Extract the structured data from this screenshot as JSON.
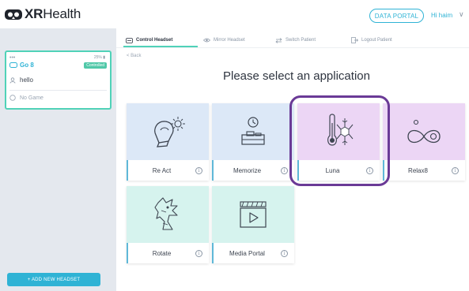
{
  "header": {
    "logo_bold": "XR",
    "logo_rest": "Health",
    "portal_button": "DATA PORTAL",
    "greeting": "Hi haim",
    "caret": "∨"
  },
  "sidebar": {
    "headset": {
      "dots": "•••",
      "battery": "25% ▮",
      "name": "Go 8",
      "status": "Controlled",
      "user": "hello",
      "game": "No Game"
    },
    "add_button": "+ ADD NEW HEADSET"
  },
  "tabs": [
    {
      "label": "Control Headset",
      "active": true,
      "icon": "control-icon"
    },
    {
      "label": "Mirror Headset",
      "active": false,
      "icon": "eye-icon"
    },
    {
      "label": "Switch Patient",
      "active": false,
      "icon": "switch-icon"
    },
    {
      "label": "Logout Patient",
      "active": false,
      "icon": "logout-icon"
    }
  ],
  "back": "< Back",
  "title": "Please select an application",
  "apps": [
    {
      "label": "Re Act",
      "icon": "boxing-glove-icon",
      "bg": "#dce8f7"
    },
    {
      "label": "Memorize",
      "icon": "clock-bag-icon",
      "bg": "#dce8f7"
    },
    {
      "label": "Luna",
      "icon": "thermometer-snowflake-icon",
      "bg": "#ecd6f5",
      "selected": true
    },
    {
      "label": "Relax8",
      "icon": "infinity-icon",
      "bg": "#ecd6f5"
    },
    {
      "label": "Rotate",
      "icon": "dragon-icon",
      "bg": "#d6f3ee"
    },
    {
      "label": "Media Portal",
      "icon": "video-player-icon",
      "bg": "#d6f3ee"
    }
  ],
  "info_glyph": "i",
  "colors": {
    "accent": "#2fb3d5",
    "teal": "#50d2b8",
    "selection_ring": "#6a3a96",
    "sidebar_bg": "#e4e8ee"
  }
}
